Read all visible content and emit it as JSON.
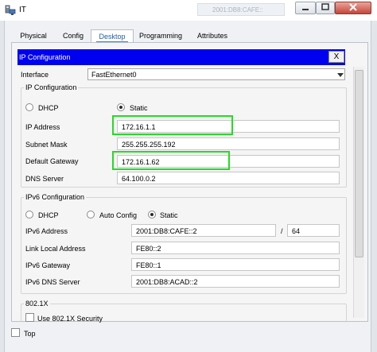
{
  "window": {
    "title": "IT",
    "ghost_title": "2001:DB8:CAFE::"
  },
  "tabs": [
    {
      "label": "Physical"
    },
    {
      "label": "Config"
    },
    {
      "label": "Desktop"
    },
    {
      "label": "Programming"
    },
    {
      "label": "Attributes"
    }
  ],
  "active_tab": "Desktop",
  "ip_config": {
    "header": "IP Configuration",
    "close_label": "X",
    "interface_label": "Interface",
    "interface_value": "FastEthernet0",
    "ipv4": {
      "group_title": "IP Configuration",
      "dhcp_label": "DHCP",
      "static_label": "Static",
      "selected": "Static",
      "ip_address_label": "IP Address",
      "ip_address": "172.16.1.1",
      "subnet_mask_label": "Subnet Mask",
      "subnet_mask": "255.255.255.192",
      "gateway_label": "Default Gateway",
      "gateway": "172.16.1.62",
      "dns_label": "DNS Server",
      "dns": "64.100.0.2"
    },
    "ipv6": {
      "group_title": "IPv6 Configuration",
      "dhcp_label": "DHCP",
      "auto_label": "Auto Config",
      "static_label": "Static",
      "selected": "Static",
      "address_label": "IPv6 Address",
      "address": "2001:DB8:CAFE::2",
      "prefix_sep": "/",
      "prefix": "64",
      "link_local_label": "Link Local Address",
      "link_local": "FE80::2",
      "gateway_label": "IPv6 Gateway",
      "gateway": "FE80::1",
      "dns_label": "IPv6 DNS Server",
      "dns": "2001:DB8:ACAD::2"
    },
    "dot1x": {
      "group_title": "802.1X",
      "use_label": "Use 802.1X Security"
    }
  },
  "footer": {
    "top_label": "Top"
  },
  "colors": {
    "header_blue": "#0000f0",
    "highlight_green": "#22dd22",
    "tab_active_text": "#1e5ea8"
  }
}
